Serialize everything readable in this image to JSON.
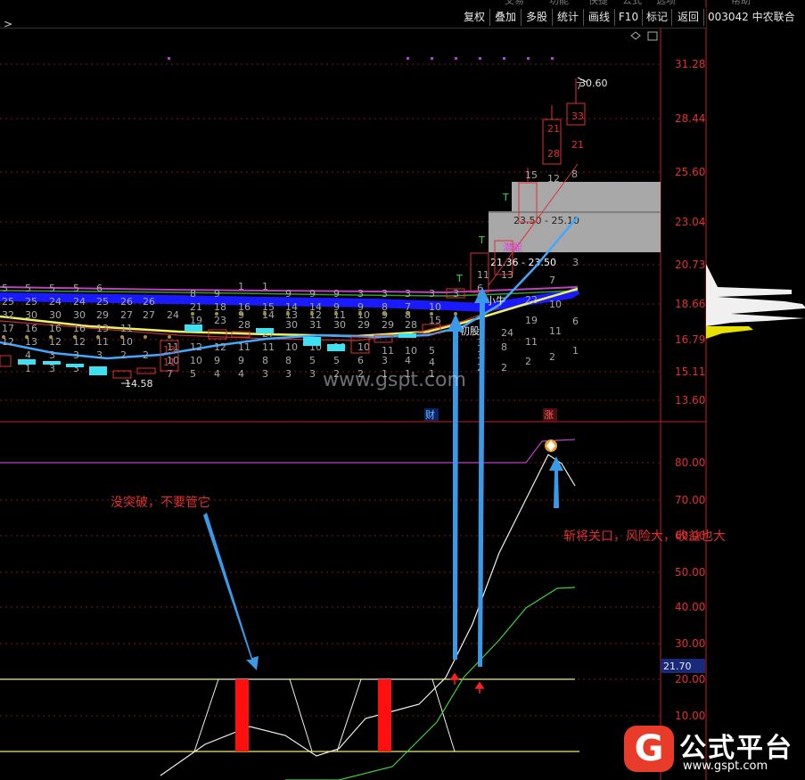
{
  "toolbar": {
    "buttons": [
      "复权",
      "叠加",
      "多股",
      "统计",
      "画线",
      "F10",
      "标记",
      "返回"
    ]
  },
  "stock": {
    "title": "003042 中农联合"
  },
  "top_strip": [
    "交易",
    "功能",
    "快捷",
    "公式",
    "选项",
    "帮助"
  ],
  "price_axis": [
    "31.28",
    "28.44",
    "25.60",
    "23.04",
    "20.73",
    "18.66",
    "16.79",
    "15.11",
    "13.60"
  ],
  "indicator_axis": [
    "80.00",
    "70.00",
    "60.00",
    "50.00",
    "40.00",
    "30.00",
    "20.00",
    "10.00"
  ],
  "indicator_current": "21.70",
  "price_labels": {
    "high": "30.60",
    "low": "14.58",
    "zone_upper": "23.50 - 25.10",
    "zone_lower": "21.36 - 23.50"
  },
  "candle_labels": [
    "33",
    "21",
    "28",
    "15",
    "12",
    "8",
    "21",
    "13",
    "11",
    "6",
    "3",
    "7"
  ],
  "signals": {
    "t_mark": "T",
    "cai": "财",
    "zhang": "涨",
    "initial_buy": "初股",
    "small_buy": "小牛",
    "potential": "潜能"
  },
  "annotations": {
    "no_breakout": "没突破，不要管它",
    "breakout": "斩将关口，风险大，收益也大"
  },
  "watermark": "www.gspt.com",
  "brand": {
    "name": "公式平台",
    "url": "www.gspt.com",
    "mark": "G"
  },
  "colors": {
    "axis": "#e03030",
    "up": "#e03030",
    "down": "#40e0f0",
    "accent_blue": "#3a9ae8",
    "ma_yellow": "#f0f060"
  }
}
